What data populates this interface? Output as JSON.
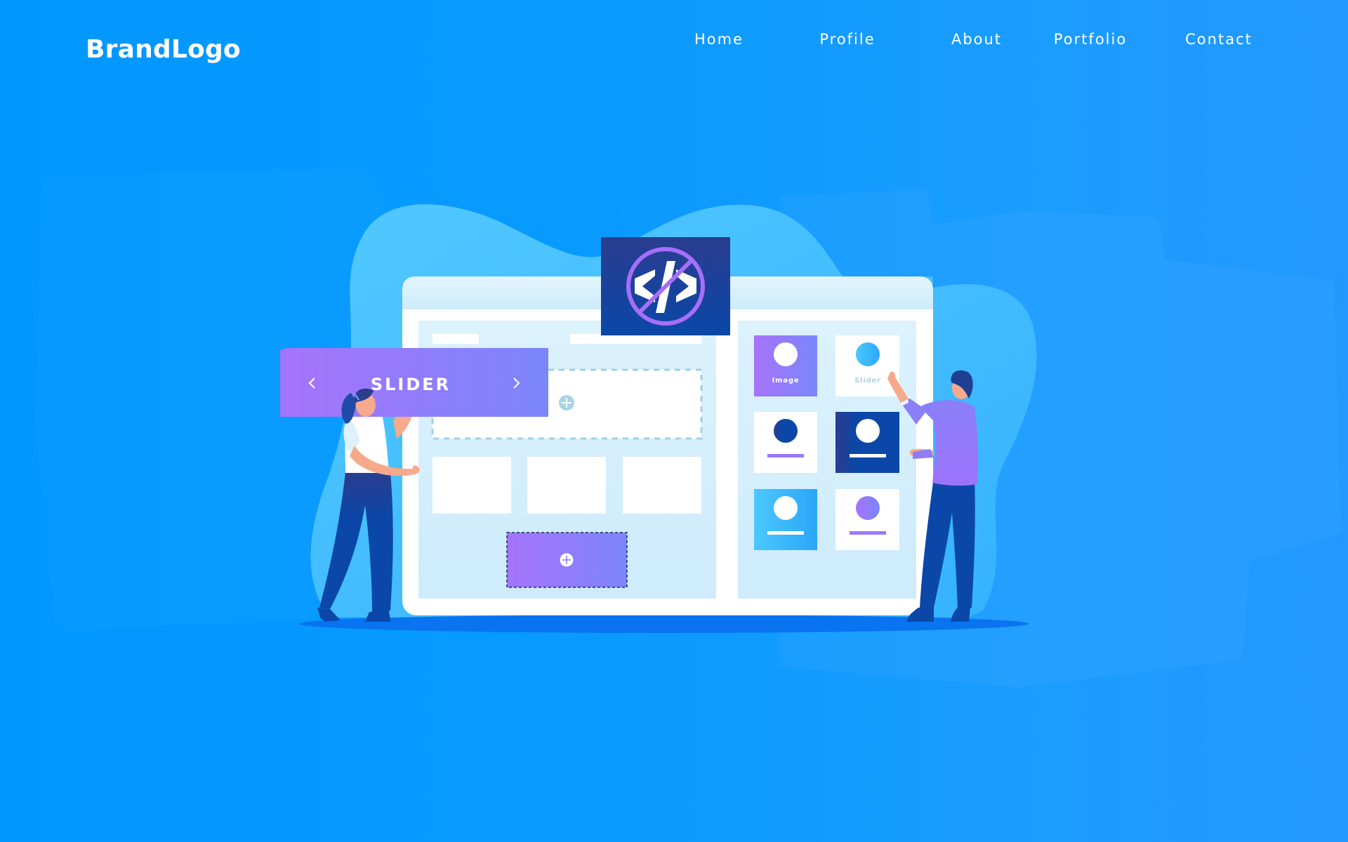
{
  "header": {
    "brand": "BrandLogo",
    "nav": [
      {
        "label": "Home"
      },
      {
        "label": "Profile"
      },
      {
        "label": "About"
      },
      {
        "label": "Portfolio"
      },
      {
        "label": "Contact"
      }
    ]
  },
  "illustration": {
    "code_badge_icon": "no-code-icon",
    "slider_widget": {
      "label": "SLIDER",
      "prev_icon": "chevron-left-icon",
      "next_icon": "chevron-right-icon"
    },
    "widget_tiles": [
      {
        "label": "Image",
        "style": "purple"
      },
      {
        "label": "Slider",
        "style": "white-blue"
      },
      {
        "label": "",
        "style": "white-navy"
      },
      {
        "label": "",
        "style": "navy"
      },
      {
        "label": "",
        "style": "sky"
      },
      {
        "label": "",
        "style": "white-purple"
      }
    ]
  },
  "colors": {
    "background": "#0098ff",
    "blob": "#4cc4ff",
    "navy": "#0a47a8",
    "purple_start": "#a374fb",
    "purple_end": "#7b85fb",
    "pane": "#d5effc"
  }
}
